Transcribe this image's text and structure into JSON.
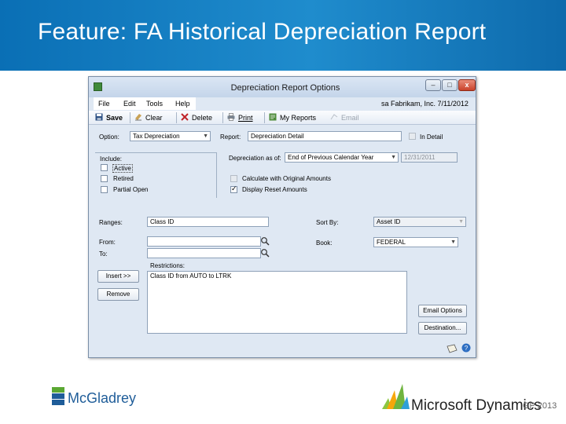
{
  "slide": {
    "title": "Feature: FA Historical Depreciation Report"
  },
  "window": {
    "title": "Depreciation Report Options",
    "controls": {
      "minimize": "–",
      "maximize": "□",
      "close": "x"
    }
  },
  "menu": {
    "items": [
      "File",
      "Edit",
      "Tools",
      "Help"
    ],
    "user_info": "sa  Fabrikam, Inc.  7/11/2012"
  },
  "toolbar": {
    "save": "Save",
    "clear": "Clear",
    "delete": "Delete",
    "print": "Print",
    "my_reports": "My Reports",
    "email": "Email"
  },
  "form": {
    "option_label": "Option:",
    "option_value": "Tax Depreciation",
    "report_label": "Report:",
    "report_value": "Depreciation Detail",
    "in_detail_label": "In Detail",
    "depreciation_as_of_label": "Depreciation as of:",
    "depreciation_as_of_value": "End of Previous Calendar Year",
    "date_value": "12/31/2011",
    "include_label": "Include:",
    "include_options": [
      "Active",
      "Retired",
      "Partial Open"
    ],
    "include_checked": [
      false,
      false,
      false
    ],
    "calc_original_label": "Calculate with Original Amounts",
    "display_reset_label": "Display Reset Amounts",
    "display_reset_checked": true,
    "ranges_label": "Ranges:",
    "ranges_value": "Class ID",
    "sort_by_label": "Sort By:",
    "sort_by_value": "Asset ID",
    "from_label": "From:",
    "from_value": "",
    "to_label": "To:",
    "to_value": "",
    "book_label": "Book:",
    "book_value": "FEDERAL",
    "insert_button": "Insert >>",
    "remove_button": "Remove",
    "restrictions_label": "Restrictions:",
    "restrictions_value": "Class ID from AUTO to LTRK",
    "email_options_button": "Email Options",
    "destination_button": "Destination..."
  },
  "footer": {
    "left_logo": "McGladrey",
    "right_logo": "Microsoft Dynamics",
    "right_logo_suffix": "GP 2013"
  },
  "colors": {
    "header_blue": "#1a7fc1",
    "mcgladrey_blue": "#1f5d99",
    "mcgladrey_green": "#5aa832"
  }
}
